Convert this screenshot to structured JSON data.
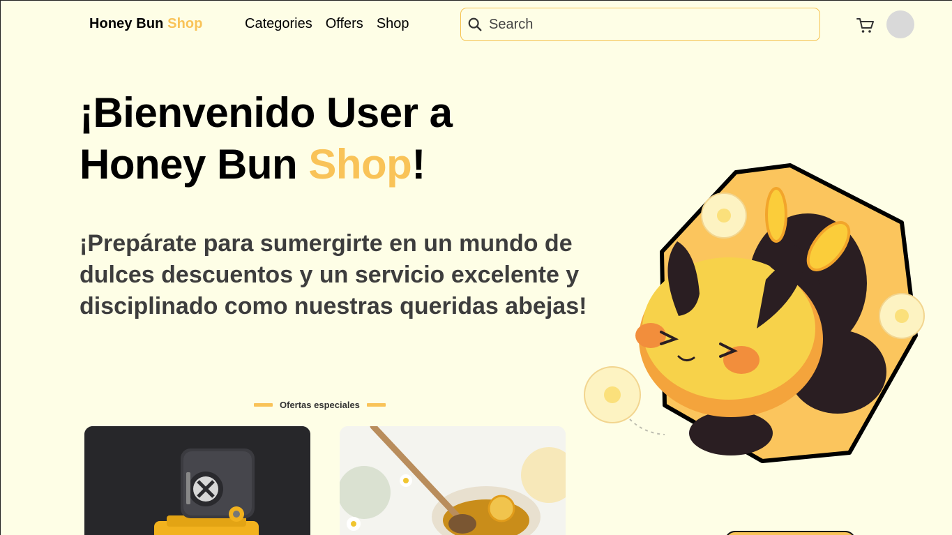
{
  "header": {
    "logo_part1": "Honey Bun",
    "logo_part2": "Shop",
    "nav": [
      "Categories",
      "Offers",
      "Shop"
    ],
    "search_placeholder": "Search"
  },
  "hero": {
    "title_line1": "¡Bienvenido User a",
    "title_line2_part1": "Honey Bun",
    "title_line2_accent": "Shop",
    "title_line2_end": "!",
    "subtitle": "¡Prepárate para sumergirte en un mundo de dulces descuentos y un servicio excelente y disciplinado como nuestras queridas abejas!"
  },
  "offers": {
    "heading": "Ofertas especiales"
  },
  "colors": {
    "background": "#fefee6",
    "accent": "#f9c358",
    "text": "#000000",
    "subtitle": "#3d3d3d"
  },
  "icons": [
    "search-icon",
    "cart-icon"
  ]
}
